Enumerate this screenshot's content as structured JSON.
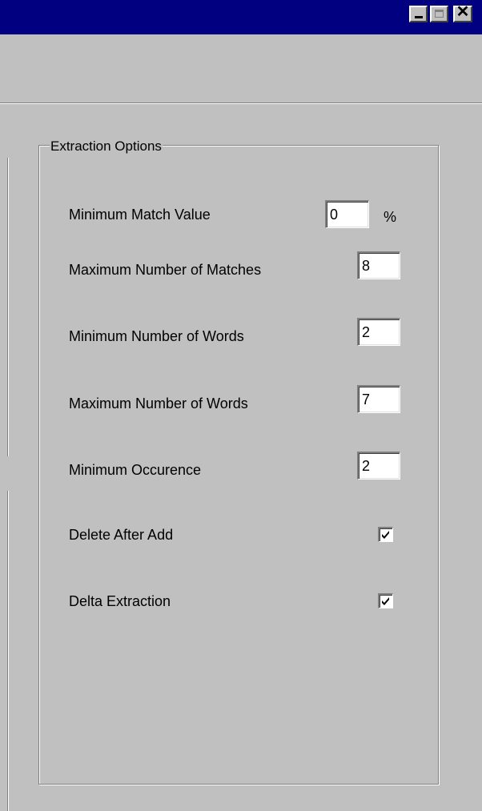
{
  "window": {
    "minimize_icon": "minimize-icon",
    "maximize_icon": "maximize-icon",
    "close_icon": "close-icon",
    "close_glyph": "✕"
  },
  "extraction_options": {
    "title": "Extraction Options",
    "minimum_match_value": {
      "label": "Minimum Match Value",
      "value": "0",
      "unit": "%"
    },
    "maximum_number_of_matches": {
      "label": "Maximum Number of Matches",
      "value": "8"
    },
    "minimum_number_of_words": {
      "label": "Minimum Number of Words",
      "value": "2"
    },
    "maximum_number_of_words": {
      "label": "Maximum Number of Words",
      "value": "7"
    },
    "minimum_occurence": {
      "label": "Minimum Occurence",
      "value": "2"
    },
    "delete_after_add": {
      "label": "Delete After Add",
      "checked": true
    },
    "delta_extraction": {
      "label": "Delta Extraction",
      "checked": true
    }
  }
}
